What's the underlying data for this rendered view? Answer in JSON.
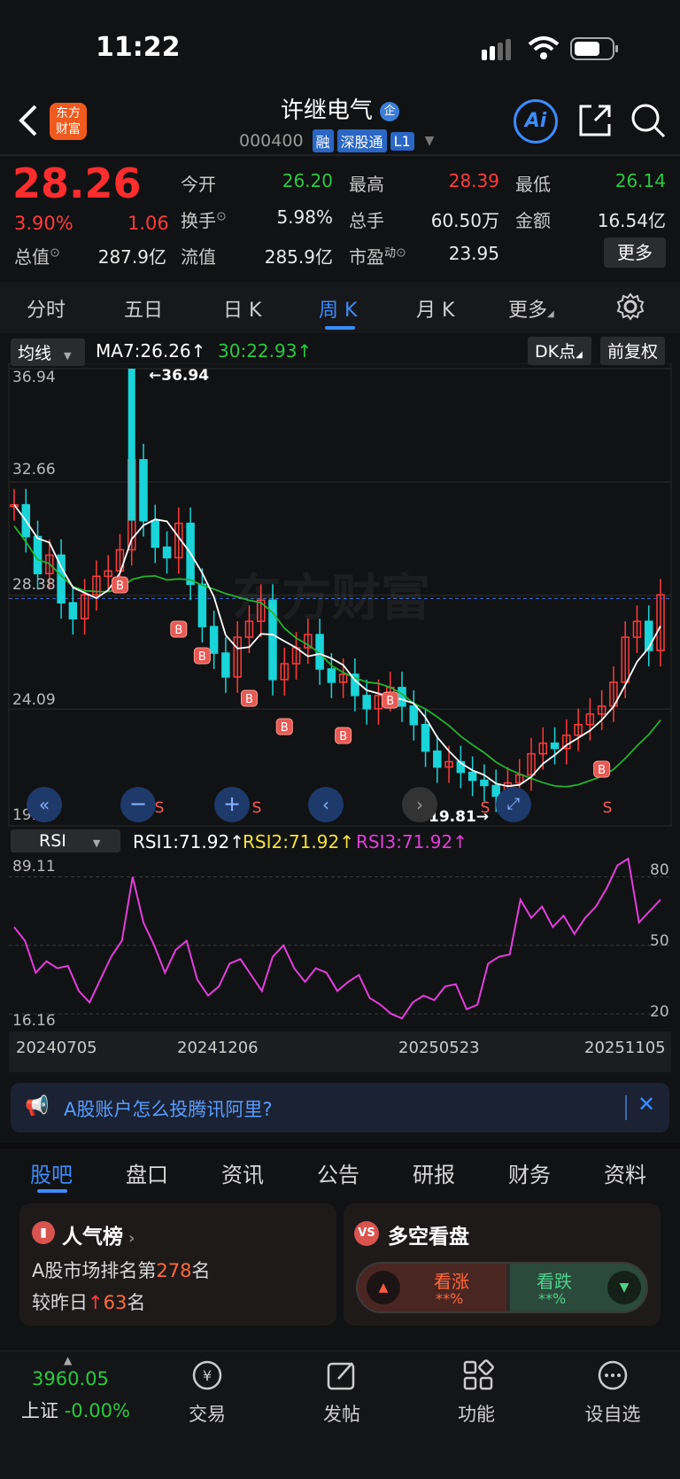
{
  "status": {
    "time": "11:22"
  },
  "header": {
    "logo_line1": "东方",
    "logo_line2": "财富",
    "title": "许继电气",
    "title_badge": "企",
    "code": "000400",
    "tags": [
      "融",
      "深股通",
      "L1"
    ],
    "ai_label": "Ai"
  },
  "quote": {
    "price": "28.26",
    "change_pct": "3.90%",
    "change": "1.06",
    "rows": [
      [
        {
          "label": "今开",
          "value": "26.20",
          "color": "green"
        },
        {
          "label": "最高",
          "value": "28.39",
          "color": "red"
        },
        {
          "label": "最低",
          "value": "26.14",
          "color": "green"
        }
      ],
      [
        {
          "label": "换手",
          "value": "5.98%",
          "color": "white"
        },
        {
          "label": "总手",
          "value": "60.50万",
          "color": "white"
        },
        {
          "label": "金额",
          "value": "16.54亿",
          "color": "white"
        }
      ]
    ],
    "total_value_label": "总值",
    "total_value": "287.9亿",
    "float_value_label": "流值",
    "float_value": "285.9亿",
    "pe_label": "市盈",
    "pe_sup": "动",
    "pe_value": "23.95",
    "more_label": "更多"
  },
  "tabs": [
    "分时",
    "五日",
    "日 K",
    "周 K",
    "月 K",
    "更多"
  ],
  "chart_toolbar": {
    "ma_select": "均线",
    "ma7": "MA7:26.26",
    "ma30": "30:22.93",
    "dk_label": "DK点",
    "adjust_label": "前复权"
  },
  "chart_data": {
    "type": "candlestick",
    "y_ticks": [
      "36.94",
      "32.66",
      "28.38",
      "24.09",
      "19.81"
    ],
    "ylim": [
      19.81,
      36.94
    ],
    "max_label": "36.94",
    "min_label": "19.81",
    "x_ticks": [
      "20240705",
      "20241206",
      "20250523",
      "20251105"
    ],
    "watermark": "东方财富",
    "rsi": {
      "select": "RSI",
      "rsi1": "RSI1:71.92",
      "rsi2": "RSI2:71.92",
      "rsi3": "RSI3:71.92",
      "y_top": "89.11",
      "y_bottom": "16.16",
      "levels": [
        "80",
        "50",
        "20"
      ]
    }
  },
  "banner": {
    "text": "A股账户怎么投腾讯阿里?"
  },
  "bottom_tabs": [
    "股吧",
    "盘口",
    "资讯",
    "公告",
    "研报",
    "财务",
    "资料"
  ],
  "popularity": {
    "title": "人气榜",
    "line1_pre": "A股市场排名第",
    "line1_num": "278",
    "line1_post": "名",
    "line2_pre": "较昨日",
    "line2_num": "63",
    "line2_post": "名"
  },
  "sentiment": {
    "badge": "VS",
    "title": "多空看盘",
    "bull": "看涨",
    "bull_pct": "**%",
    "bear": "看跌",
    "bear_pct": "**%"
  },
  "nav": {
    "index_value": "3960.05",
    "index_label": "上证",
    "index_change": "-0.00%",
    "items": [
      "交易",
      "发帖",
      "功能",
      "设自选"
    ]
  }
}
